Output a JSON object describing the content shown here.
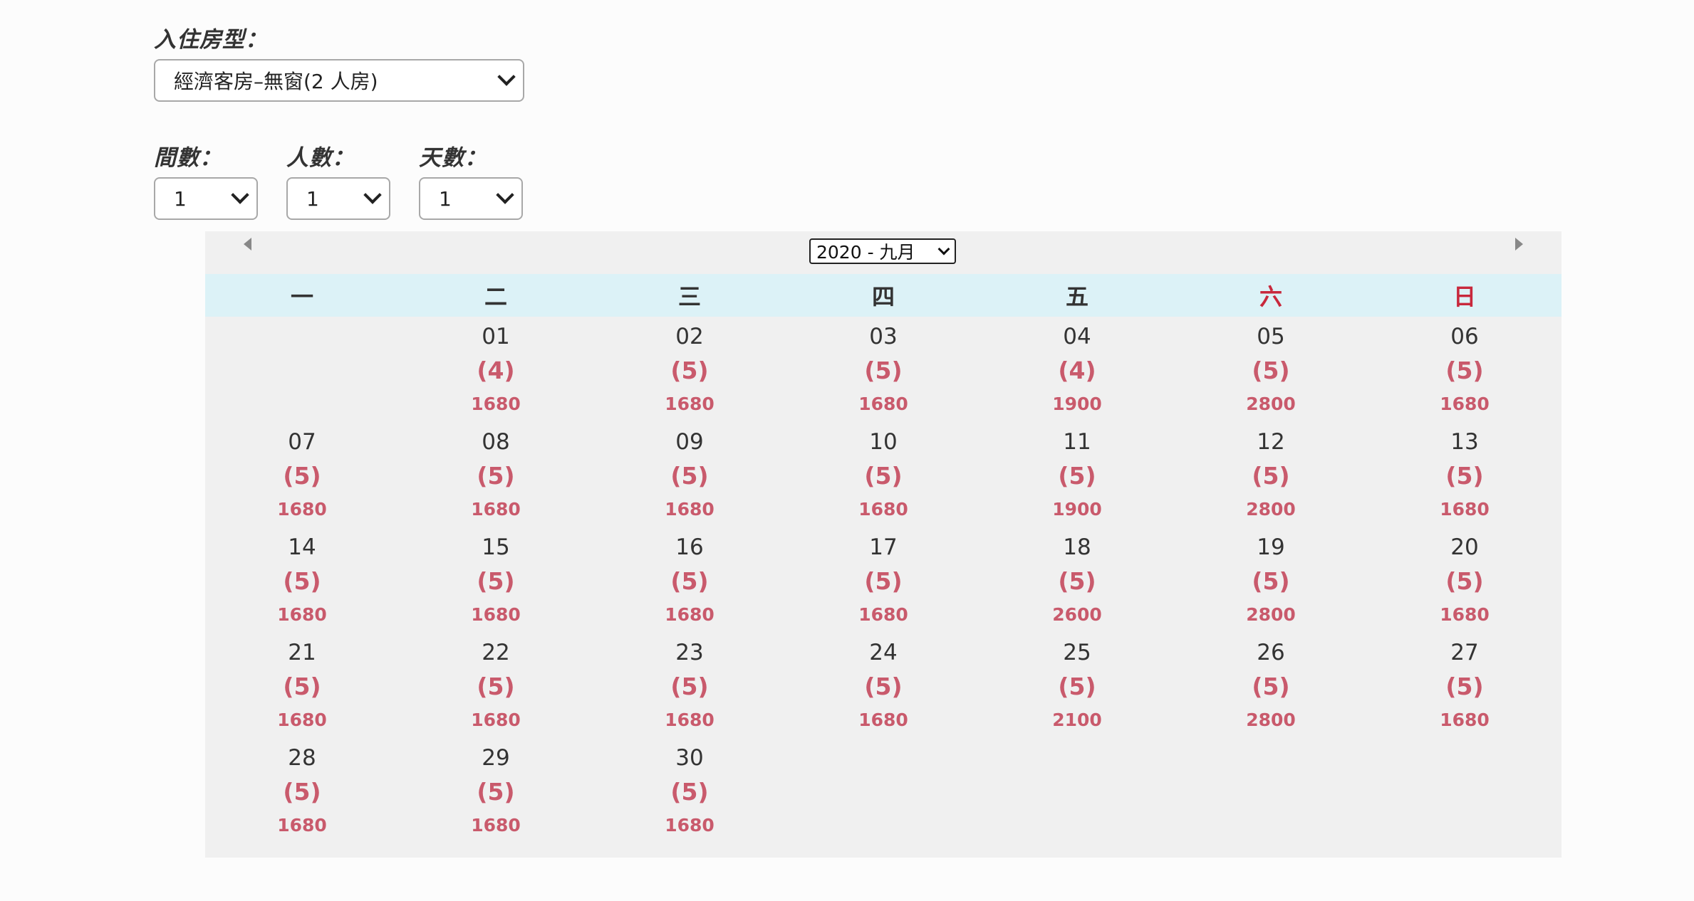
{
  "form": {
    "room_type_label": "入住房型：",
    "room_type_value": "經濟客房–無窗(2 人房)",
    "rooms_label": "間數：",
    "rooms_value": "1",
    "guests_label": "人數：",
    "guests_value": "1",
    "nights_label": "天數：",
    "nights_value": "1"
  },
  "calendar": {
    "month_value": "2020 - 九月",
    "weekdays": [
      "一",
      "二",
      "三",
      "四",
      "五",
      "六",
      "日"
    ],
    "weekend_color": "#c8283c",
    "header_bg": "#dcf2f7",
    "price_color": "#c95a6c",
    "start_offset": 1,
    "days": [
      {
        "day": "01",
        "avail": "(4)",
        "price": "1680"
      },
      {
        "day": "02",
        "avail": "(5)",
        "price": "1680"
      },
      {
        "day": "03",
        "avail": "(5)",
        "price": "1680"
      },
      {
        "day": "04",
        "avail": "(4)",
        "price": "1900"
      },
      {
        "day": "05",
        "avail": "(5)",
        "price": "2800"
      },
      {
        "day": "06",
        "avail": "(5)",
        "price": "1680"
      },
      {
        "day": "07",
        "avail": "(5)",
        "price": "1680"
      },
      {
        "day": "08",
        "avail": "(5)",
        "price": "1680"
      },
      {
        "day": "09",
        "avail": "(5)",
        "price": "1680"
      },
      {
        "day": "10",
        "avail": "(5)",
        "price": "1680"
      },
      {
        "day": "11",
        "avail": "(5)",
        "price": "1900"
      },
      {
        "day": "12",
        "avail": "(5)",
        "price": "2800"
      },
      {
        "day": "13",
        "avail": "(5)",
        "price": "1680"
      },
      {
        "day": "14",
        "avail": "(5)",
        "price": "1680"
      },
      {
        "day": "15",
        "avail": "(5)",
        "price": "1680"
      },
      {
        "day": "16",
        "avail": "(5)",
        "price": "1680"
      },
      {
        "day": "17",
        "avail": "(5)",
        "price": "1680"
      },
      {
        "day": "18",
        "avail": "(5)",
        "price": "2600"
      },
      {
        "day": "19",
        "avail": "(5)",
        "price": "2800"
      },
      {
        "day": "20",
        "avail": "(5)",
        "price": "1680"
      },
      {
        "day": "21",
        "avail": "(5)",
        "price": "1680"
      },
      {
        "day": "22",
        "avail": "(5)",
        "price": "1680"
      },
      {
        "day": "23",
        "avail": "(5)",
        "price": "1680"
      },
      {
        "day": "24",
        "avail": "(5)",
        "price": "1680"
      },
      {
        "day": "25",
        "avail": "(5)",
        "price": "2100"
      },
      {
        "day": "26",
        "avail": "(5)",
        "price": "2800"
      },
      {
        "day": "27",
        "avail": "(5)",
        "price": "1680"
      },
      {
        "day": "28",
        "avail": "(5)",
        "price": "1680"
      },
      {
        "day": "29",
        "avail": "(5)",
        "price": "1680"
      },
      {
        "day": "30",
        "avail": "(5)",
        "price": "1680"
      }
    ]
  }
}
